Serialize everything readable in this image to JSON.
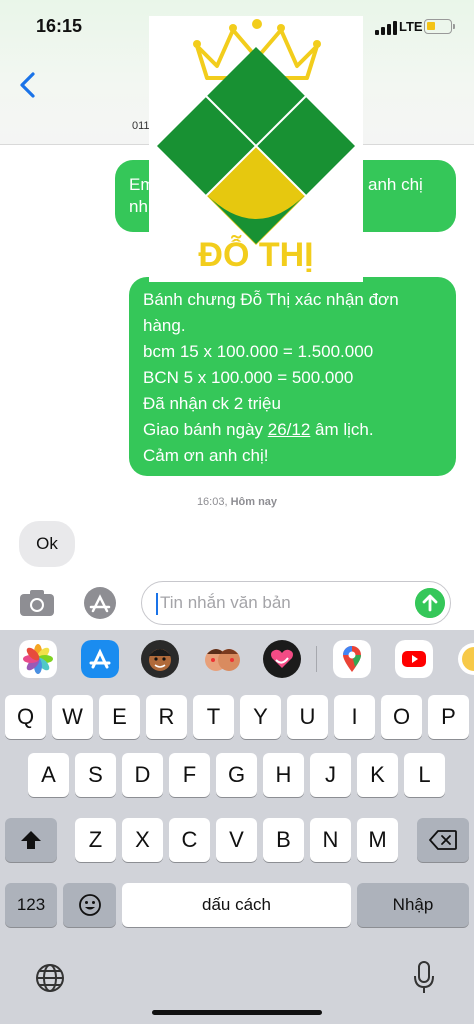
{
  "status_bar": {
    "time": "16:15",
    "network": "LTE"
  },
  "header": {
    "contact": "011"
  },
  "logo": {
    "text": "ĐỖ THỊ"
  },
  "messages": {
    "outgoing_1": {
      "left": "Em",
      "left_line2": "nh",
      "right": "anh chị"
    },
    "outgoing_2": {
      "lines": [
        "Bánh chưng Đỗ Thị xác nhận đơn",
        "hàng.",
        " bcm 15 x 100.000 = 1.500.000",
        "BCN 5 x 100.000 = 500.000",
        "Đã nhận ck 2 triệu"
      ],
      "line6_prefix": "Giao bánh ngày ",
      "line6_date": "26/12",
      "line6_suffix": " âm lịch.",
      "line7": "Cảm ơn anh chị!"
    },
    "timestamp_time": "16:03,",
    "timestamp_day": " Hôm nay",
    "incoming_1": "Ok"
  },
  "input": {
    "placeholder": "Tin nhắn văn bản"
  },
  "keyboard": {
    "row1": [
      "Q",
      "W",
      "E",
      "R",
      "T",
      "Y",
      "U",
      "I",
      "O",
      "P"
    ],
    "row2": [
      "A",
      "S",
      "D",
      "F",
      "G",
      "H",
      "J",
      "K",
      "L"
    ],
    "row3": [
      "Z",
      "X",
      "C",
      "V",
      "B",
      "N",
      "M"
    ],
    "numbers_key": "123",
    "space_key": "dấu cách",
    "return_key": "Nhập"
  },
  "colors": {
    "bubble_green": "#35c759",
    "incoming_gray": "#e9e9eb",
    "ios_blue": "#1a73e8"
  }
}
